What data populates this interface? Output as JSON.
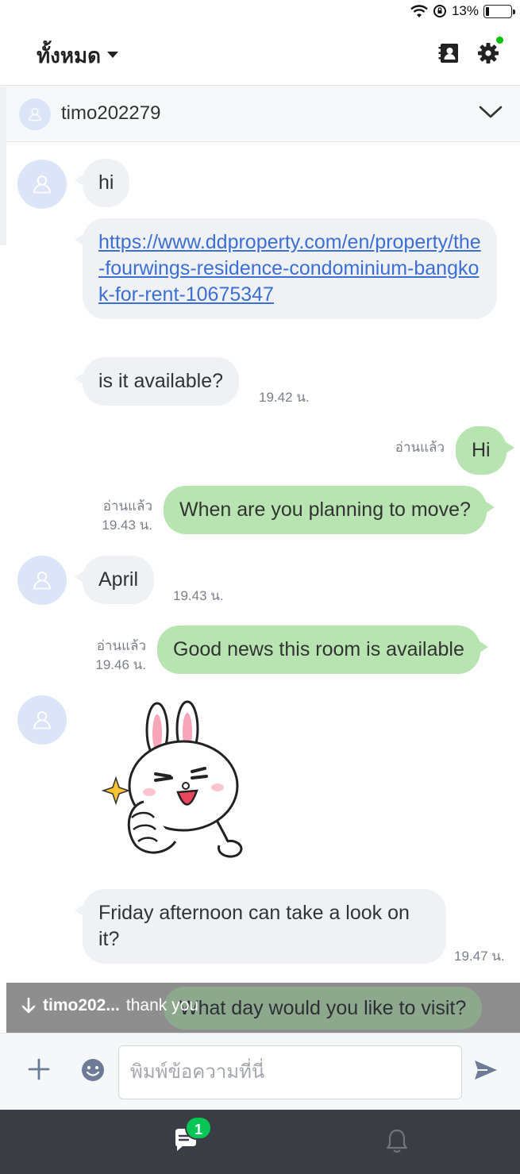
{
  "status_bar": {
    "battery": "13%"
  },
  "header": {
    "filter_label": "ทั้งหมด"
  },
  "chat": {
    "name": "timo202279"
  },
  "messages": {
    "m1": "hi",
    "m2_link": "https://www.ddproperty.com/en/property/the-fourwings-residence-condominium-bangkok-for-rent-10675347",
    "m3": "is it available?",
    "m3_time": "19.42 น.",
    "m4": "Hi",
    "m4_read": "อ่านแล้ว",
    "m5": "When are you planning to move?",
    "m5_read": "อ่านแล้ว",
    "m5_time": "19.43 น.",
    "m6": "April",
    "m6_time": "19.43 น.",
    "m7": "Good news this room is available",
    "m7_read": "อ่านแล้ว",
    "m7_time": "19.46 น.",
    "m8": "Friday afternoon can take a look on it?",
    "m8_time": "19.47 น."
  },
  "new_message": {
    "sender": "timo202...",
    "text": "thank you",
    "behind_bubble": "What day would you like to visit?"
  },
  "input": {
    "placeholder": "พิมพ์ข้อความที่นี่"
  },
  "nav": {
    "chat_badge": "1"
  },
  "colors": {
    "accent": "#06c755",
    "bubble_out": "#b7e4b0",
    "bubble_in": "#f0f1f4",
    "link": "#3b6fd4"
  }
}
